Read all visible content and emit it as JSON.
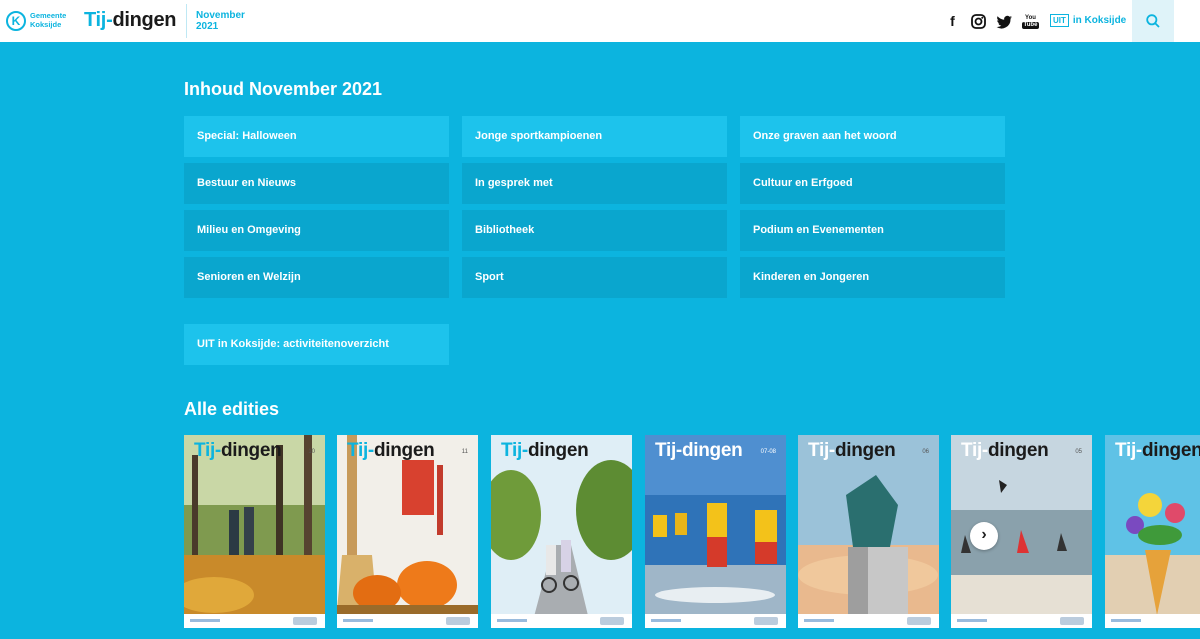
{
  "header": {
    "logo_letter": "K",
    "municipality_line1": "Gemeente",
    "municipality_line2": "Koksijde",
    "brand_prefix": "Tij-",
    "brand_rest": "dingen",
    "edition_month": "November",
    "edition_year": "2021",
    "socials": [
      "facebook-icon",
      "instagram-icon",
      "twitter-icon",
      "youtube-icon"
    ],
    "socials_text": {
      "facebook": "f",
      "youtube_1": "You",
      "youtube_2": "Tube"
    },
    "uit_box": "UIT",
    "uit_text": "in Koksijde"
  },
  "contents": {
    "title": "Inhoud November 2021",
    "tiles": [
      "Special: Halloween",
      "Jonge sportkampioenen",
      "Onze graven aan het woord",
      "Bestuur en Nieuws",
      "In gesprek met",
      "Cultuur en Erfgoed",
      "Milieu en Omgeving",
      "Bibliotheek",
      "Podium en Evenementen",
      "Senioren en Welzijn",
      "Sport",
      "Kinderen en Jongeren"
    ],
    "extra_tile": "UIT in Koksijde: activiteitenoverzicht"
  },
  "editions": {
    "title": "Alle edities",
    "cover_prefix": "Tij-",
    "cover_rest": "dingen",
    "covers": [
      {
        "number": "10"
      },
      {
        "number": "11"
      },
      {
        "number": ""
      },
      {
        "number": "07-08"
      },
      {
        "number": "06"
      },
      {
        "number": "05"
      },
      {
        "number": ""
      }
    ],
    "next_arrow": "›"
  },
  "colors": {
    "accent": "#0cb4df",
    "tile_light": "#1dc3ec",
    "tile_dark": "#0aa6ce"
  }
}
